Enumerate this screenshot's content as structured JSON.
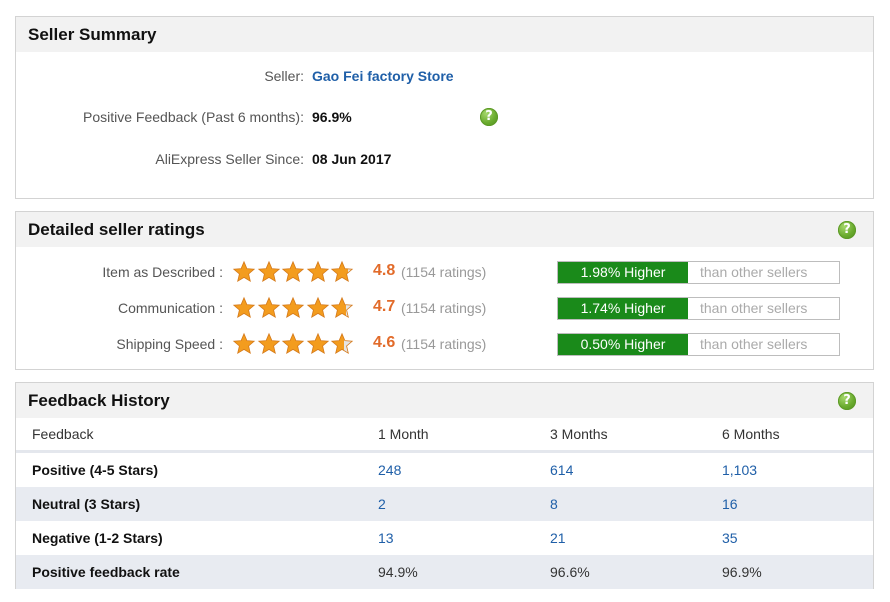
{
  "seller_summary": {
    "title": "Seller Summary",
    "seller_label": "Seller:",
    "seller_name": "Gao Fei factory Store",
    "positive_label": "Positive Feedback (Past 6 months):",
    "positive_value": "96.9%",
    "since_label": "AliExpress Seller Since:",
    "since_value": "08 Jun 2017",
    "help_glyph": "?"
  },
  "detailed_ratings": {
    "title": "Detailed seller ratings",
    "help_glyph": "?",
    "rows": [
      {
        "label": "Item as Described :",
        "score": "4.8",
        "count": "(1154 ratings)",
        "stars": 4.8,
        "higher": "1.98% Higher",
        "than": "than other sellers"
      },
      {
        "label": "Communication :",
        "score": "4.7",
        "count": "(1154 ratings)",
        "stars": 4.7,
        "higher": "1.74% Higher",
        "than": "than other sellers"
      },
      {
        "label": "Shipping Speed :",
        "score": "4.6",
        "count": "(1154 ratings)",
        "stars": 4.6,
        "higher": "0.50% Higher",
        "than": "than other sellers"
      }
    ]
  },
  "feedback_history": {
    "title": "Feedback History",
    "help_glyph": "?",
    "headers": [
      "Feedback",
      "1 Month",
      "3 Months",
      "6 Months"
    ],
    "rows": [
      {
        "label": "Positive (4-5 Stars)",
        "values": [
          "248",
          "614",
          "1,103"
        ]
      },
      {
        "label": "Neutral (3 Stars)",
        "values": [
          "2",
          "8",
          "16"
        ]
      },
      {
        "label": "Negative (1-2 Stars)",
        "values": [
          "13",
          "21",
          "35"
        ]
      },
      {
        "label": "Positive feedback rate",
        "values": [
          "94.9%",
          "96.6%",
          "96.9%"
        ]
      }
    ]
  },
  "colors": {
    "accent_green": "#1a8a1a",
    "score_orange": "#e26b2a",
    "link_blue": "#1f5fa8",
    "star_orange": "#f39c1e"
  },
  "icons": [
    "help-icon",
    "star-icon"
  ]
}
